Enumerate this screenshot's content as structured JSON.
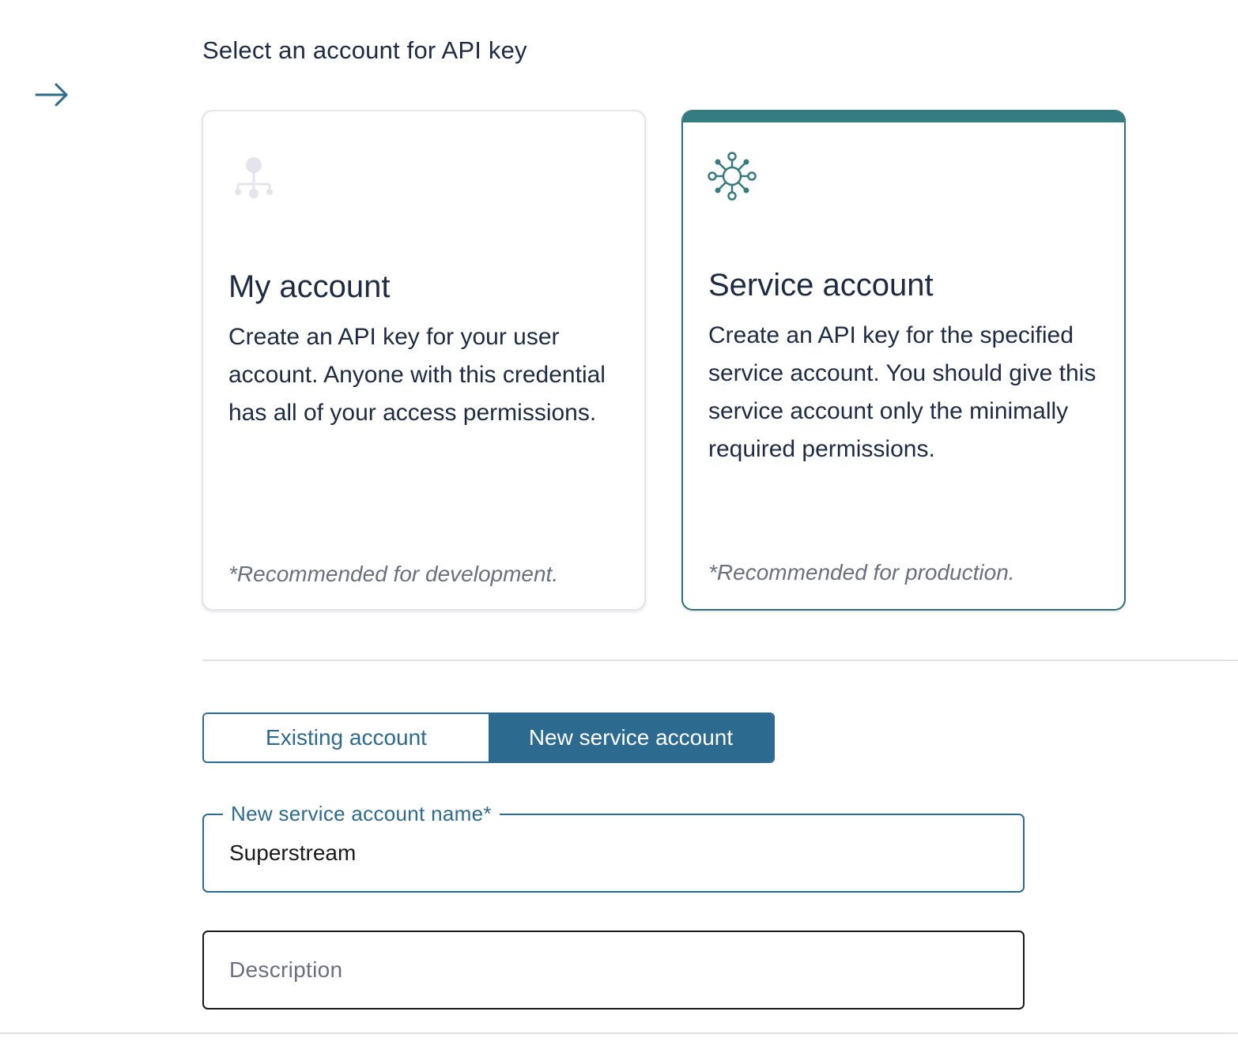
{
  "header": {
    "title": "Select an account for API key",
    "back_icon": "arrow-right-icon"
  },
  "cards": {
    "my_account": {
      "icon": "hierarchy-icon",
      "title": "My account",
      "description": "Create an API key for your user account. Anyone with this credential has all of your access permissions.",
      "recommendation": "*Recommended for development."
    },
    "service_account": {
      "icon": "network-hub-icon",
      "title": "Service account",
      "description": "Create an API key for the specified service account. You should give this service account only the minimally required permissions.",
      "recommendation": "*Recommended for production.",
      "selected": true
    }
  },
  "toggle": {
    "existing_label": "Existing account",
    "new_label": "New service account",
    "selected": "new"
  },
  "form": {
    "name_label": "New service account name*",
    "name_value": "Superstream",
    "description_placeholder": "Description",
    "description_value": ""
  },
  "colors": {
    "accent": "#2d6a8f",
    "selected_card_top": "#357b82",
    "text": "#1f2a44",
    "muted": "#6b6f82"
  }
}
